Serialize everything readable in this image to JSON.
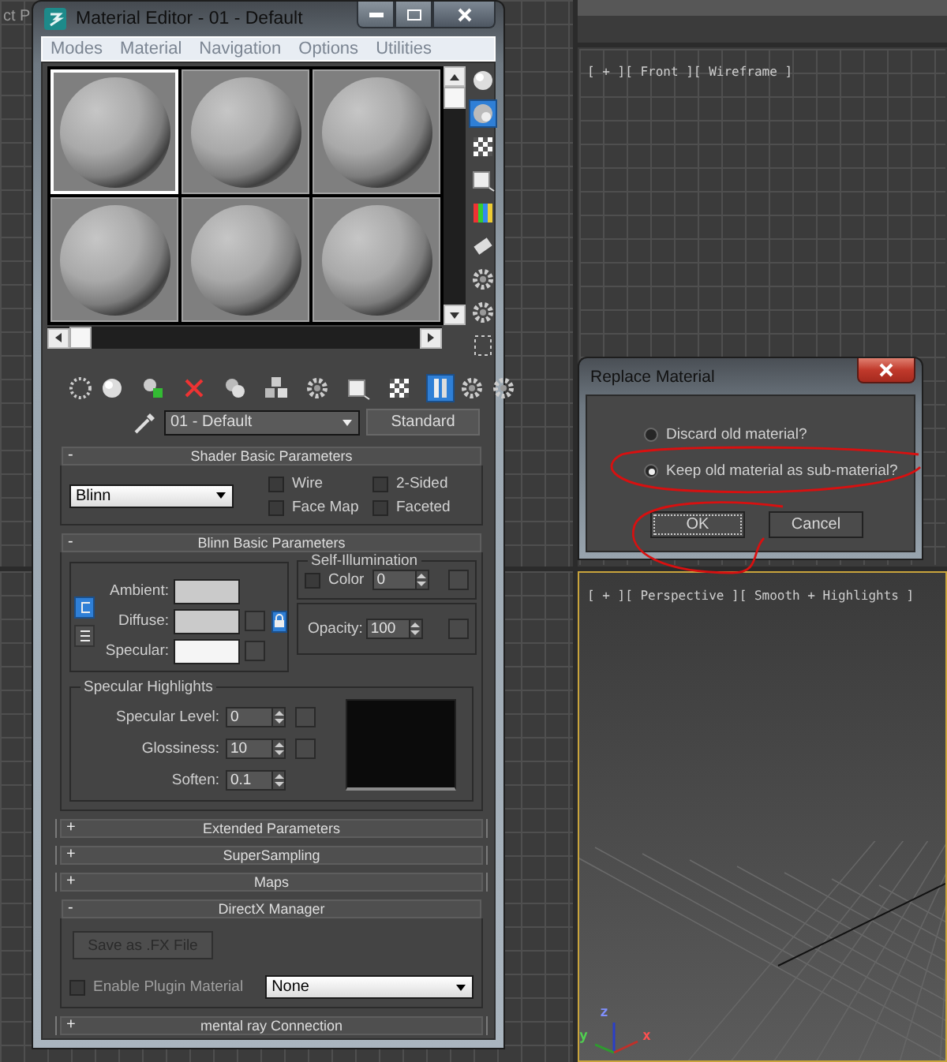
{
  "background_text": "ct P",
  "viewports": [
    {
      "kind": "grid",
      "label": "[ + ][ Front ][ Wireframe ]",
      "active": false
    },
    {
      "kind": "perspective",
      "label": "[ + ][ Perspective ][ Smooth + Highlights ]",
      "active": true,
      "axes": [
        "z",
        "y",
        "x"
      ]
    }
  ],
  "material_editor": {
    "title": "Material Editor - 01 - Default",
    "menu": [
      "Modes",
      "Material",
      "Navigation",
      "Options",
      "Utilities"
    ],
    "slots": [
      {
        "selected": true
      },
      {
        "selected": false
      },
      {
        "selected": false
      },
      {
        "selected": false
      },
      {
        "selected": false
      },
      {
        "selected": false
      }
    ],
    "side_tools": [
      {
        "kind": "sphere",
        "on": false
      },
      {
        "kind": "backlight",
        "on": true
      },
      {
        "kind": "checker",
        "on": false
      },
      {
        "kind": "square",
        "on": false
      },
      {
        "kind": "color-bars",
        "on": false
      },
      {
        "kind": "film",
        "on": false
      },
      {
        "kind": "gear",
        "on": false
      },
      {
        "kind": "gear",
        "on": false
      },
      {
        "kind": "dotted-box",
        "on": false
      }
    ],
    "tools": [
      {
        "kind": "dotted-sphere",
        "on": false
      },
      {
        "kind": "sphere",
        "on": false
      },
      {
        "kind": "sphere-square",
        "on": false
      },
      {
        "kind": "cross",
        "on": false
      },
      {
        "kind": "two-spheres",
        "on": false
      },
      {
        "kind": "cubes",
        "on": false
      },
      {
        "kind": "gear",
        "on": false
      },
      {
        "kind": "square",
        "on": false
      },
      {
        "kind": "checker",
        "on": false
      },
      {
        "kind": "bars",
        "on": true
      },
      {
        "kind": "gear",
        "on": false
      },
      {
        "kind": "gear",
        "on": false
      }
    ],
    "material_name": "01 - Default",
    "material_type": "Standard",
    "rollouts": [
      {
        "kind": "shader",
        "toggle": "-",
        "title": "Shader Basic Parameters",
        "expanded": true,
        "shader": "Blinn",
        "options": [
          {
            "label": "Wire",
            "checked": false
          },
          {
            "label": "2-Sided",
            "checked": false
          },
          {
            "label": "Face Map",
            "checked": false
          },
          {
            "label": "Faceted",
            "checked": false
          }
        ]
      },
      {
        "kind": "blinn",
        "toggle": "-",
        "title": "Blinn Basic Parameters",
        "expanded": true,
        "color_modes": [
          {
            "selected": true
          },
          {
            "selected": false
          }
        ],
        "colors": [
          {
            "label": "Ambient:",
            "color": "#cacaca",
            "map_button": false
          },
          {
            "label": "Diffuse:",
            "color": "#cacaca",
            "map_button": true
          },
          {
            "label": "Specular:",
            "color": "#f5f5f5",
            "map_button": true
          }
        ],
        "lock": true,
        "self_illumination": {
          "title": "Self-Illumination",
          "label": "Color",
          "checked": false,
          "value": "0"
        },
        "opacity": {
          "label": "Opacity:",
          "value": "100"
        },
        "specular_highlights": {
          "title": "Specular Highlights",
          "rows": [
            {
              "label": "Specular Level:",
              "value": "0",
              "map_button": true
            },
            {
              "label": "Glossiness:",
              "value": "10",
              "map_button": true
            },
            {
              "label": "Soften:",
              "value": "0.1",
              "map_button": false
            }
          ]
        }
      },
      {
        "kind": "collapsed",
        "toggle": "+",
        "title": "Extended Parameters",
        "expanded": false
      },
      {
        "kind": "collapsed",
        "toggle": "+",
        "title": "SuperSampling",
        "expanded": false
      },
      {
        "kind": "collapsed",
        "toggle": "+",
        "title": "Maps",
        "expanded": false
      },
      {
        "kind": "directx",
        "toggle": "-",
        "title": "DirectX Manager",
        "expanded": true,
        "button": {
          "label": "Save as .FX File",
          "disabled": true
        },
        "plugin": {
          "label": "Enable Plugin Material",
          "checked": false
        },
        "plugin_choice": "None"
      },
      {
        "kind": "collapsed",
        "toggle": "+",
        "title": "mental ray Connection",
        "expanded": false
      }
    ]
  },
  "dialog": {
    "title": "Replace Material",
    "options": [
      {
        "label": "Discard old material?",
        "selected": false
      },
      {
        "label": "Keep old material as sub-material?",
        "selected": true
      }
    ],
    "buttons": [
      {
        "label": "OK",
        "focused": true
      },
      {
        "label": "Cancel",
        "focused": false
      }
    ]
  }
}
